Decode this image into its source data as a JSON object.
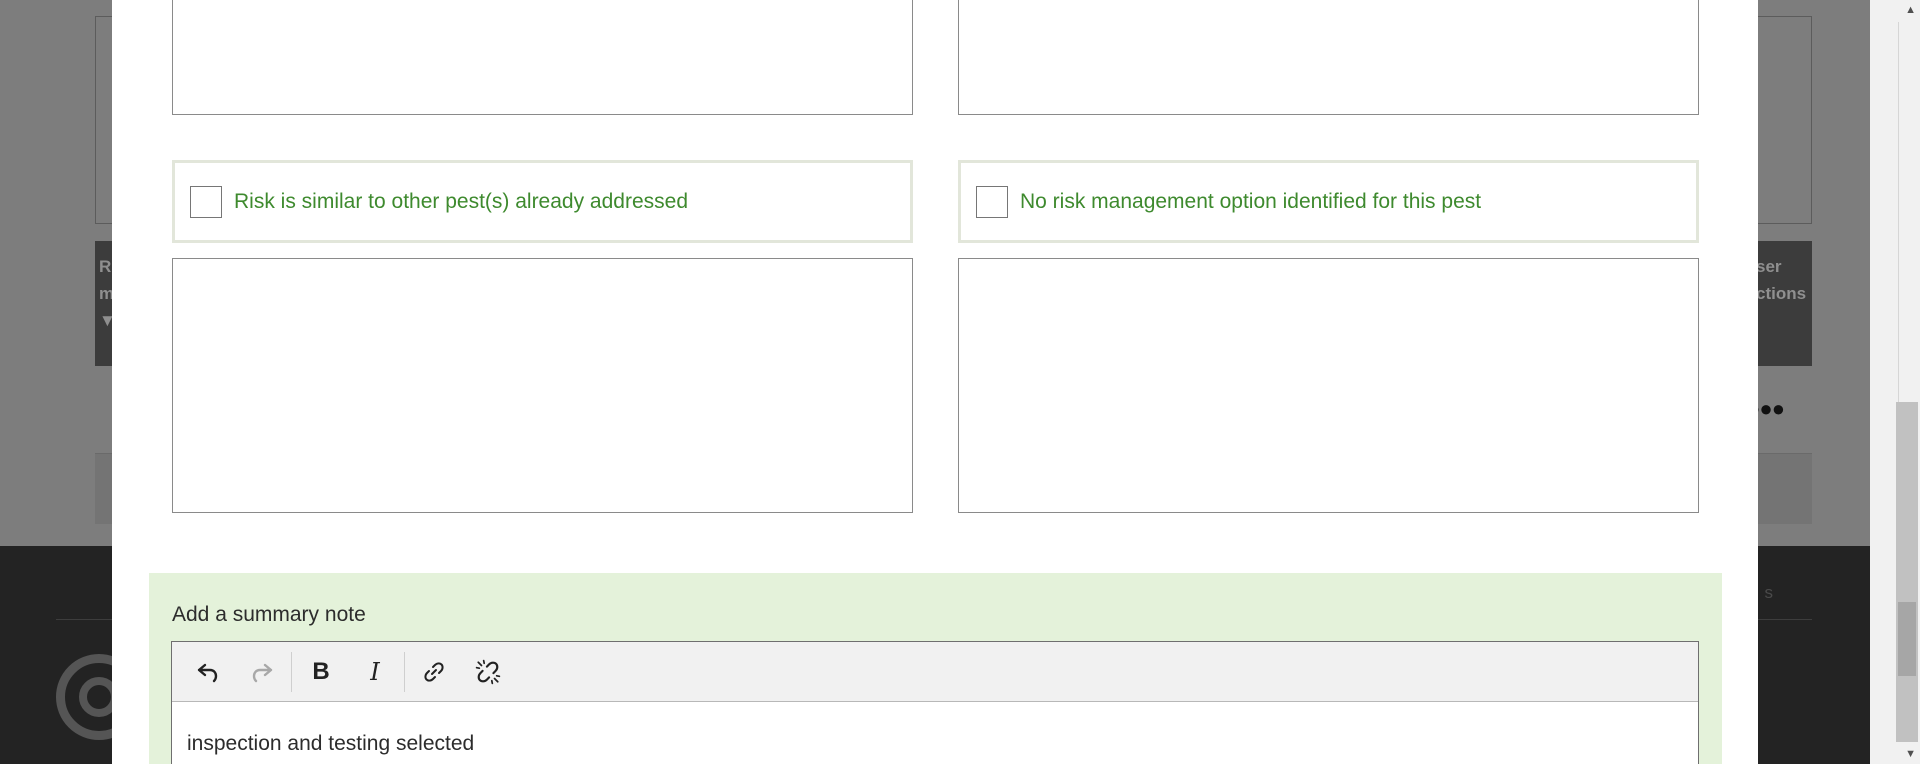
{
  "background": {
    "table_header_left": "R\nm",
    "table_header_right": "ser\nctions",
    "row_menu_icon": "ellipsis-icon",
    "footer_text": "s"
  },
  "modal": {
    "checkboxes": [
      {
        "label": "Risk is similar to other pest(s) already addressed",
        "checked": false
      },
      {
        "label": "No risk management option identified for this pest",
        "checked": false
      }
    ],
    "summary": {
      "title": "Add a summary note",
      "toolbar": [
        {
          "name": "undo",
          "icon": "undo-icon",
          "enabled": true
        },
        {
          "name": "redo",
          "icon": "redo-icon",
          "enabled": false
        },
        {
          "name": "bold",
          "icon": "bold-icon",
          "enabled": true,
          "glyph": "B"
        },
        {
          "name": "italic",
          "icon": "italic-icon",
          "enabled": true,
          "glyph": "I"
        },
        {
          "name": "link",
          "icon": "link-icon",
          "enabled": true
        },
        {
          "name": "unlink",
          "icon": "unlink-icon",
          "enabled": true
        }
      ],
      "content": "inspection and testing selected"
    }
  },
  "colors": {
    "checkbox_label": "#3e8a2e",
    "summary_background": "#e4f2da",
    "overlay": "#7d7d7d"
  }
}
